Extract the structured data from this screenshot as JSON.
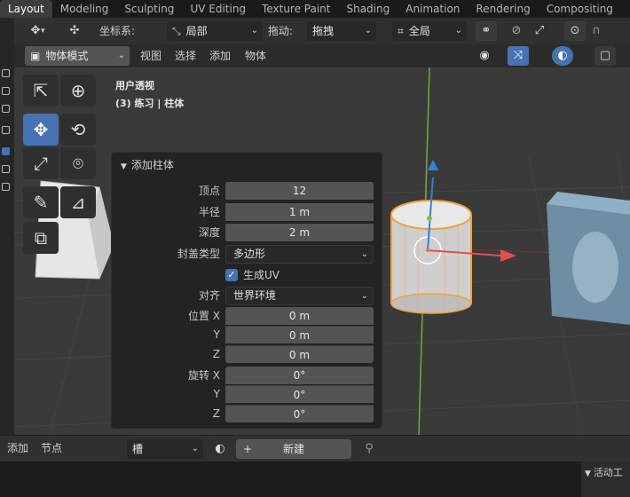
{
  "workspace_tabs": [
    "Layout",
    "Modeling",
    "Sculpting",
    "UV Editing",
    "Texture Paint",
    "Shading",
    "Animation",
    "Rendering",
    "Compositing"
  ],
  "header": {
    "coord_label": "坐标系:",
    "coord_value": "局部",
    "drag_label": "拖动:",
    "drag_value": "拖拽",
    "pivot_value": "全局",
    "mode_value": "物体模式",
    "menu": [
      "视图",
      "选择",
      "添加",
      "物体"
    ]
  },
  "viewport": {
    "view_name": "用户透视",
    "collection_info": "(3) 练习 | 柱体"
  },
  "operator_panel": {
    "title": "添加柱体",
    "fields": [
      {
        "label": "顶点",
        "value": "12"
      },
      {
        "label": "半径",
        "value": "1 m"
      },
      {
        "label": "深度",
        "value": "2 m"
      }
    ],
    "cap_type_label": "封盖类型",
    "cap_type_value": "多边形",
    "generate_uv_label": "生成UV",
    "generate_uv_checked": true,
    "align_label": "对齐",
    "align_value": "世界环境",
    "location_label": "位置 X",
    "location": [
      "0 m",
      "0 m",
      "0 m"
    ],
    "rotation_label": "旋转 X",
    "rotation": [
      "0°",
      "0°",
      "0°"
    ],
    "axis_y": "Y",
    "axis_z": "Z"
  },
  "bottom": {
    "add_label": "添加",
    "node_label": "节点",
    "slot_value": "槽",
    "new_label": "新建",
    "side_panel_label": "活动工"
  },
  "colors": {
    "accent": "#4772b3",
    "selection_orange": "#f0a040",
    "axis_red": "#e05050",
    "axis_green": "#80c040",
    "axis_blue": "#3080e0"
  }
}
